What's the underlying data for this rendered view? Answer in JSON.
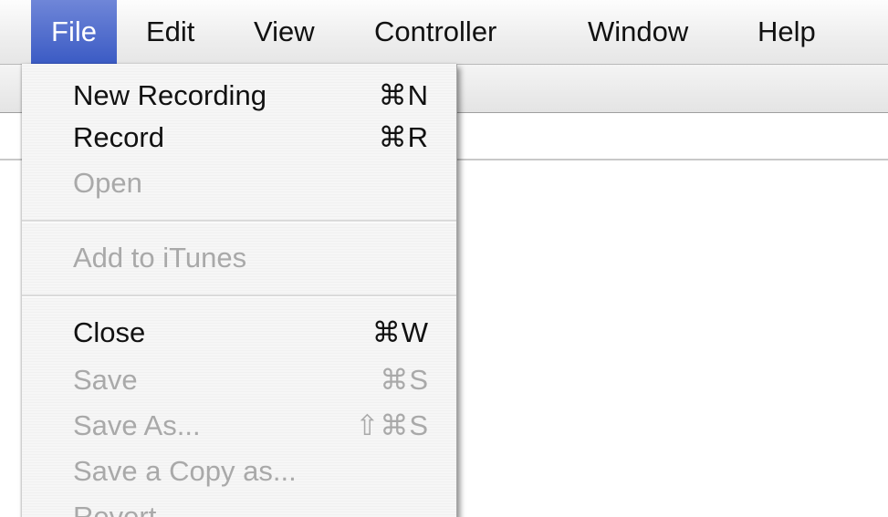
{
  "menubar": {
    "items": [
      {
        "label": "File"
      },
      {
        "label": "Edit"
      },
      {
        "label": "View"
      },
      {
        "label": "Controller"
      },
      {
        "label": "Window"
      },
      {
        "label": "Help"
      }
    ]
  },
  "file_menu": {
    "items": [
      {
        "label": "New Recording",
        "shortcut": "⌘N",
        "enabled": true
      },
      {
        "label": "Record",
        "shortcut": "⌘R",
        "enabled": true
      },
      {
        "label": "Open",
        "shortcut": "",
        "enabled": false
      },
      {
        "label": "Add to iTunes",
        "shortcut": "",
        "enabled": false
      },
      {
        "label": "Close",
        "shortcut": "⌘W",
        "enabled": true
      },
      {
        "label": "Save",
        "shortcut": "⌘S",
        "enabled": false
      },
      {
        "label": "Save As...",
        "shortcut": "⇧⌘S",
        "enabled": false
      },
      {
        "label": "Save a Copy as...",
        "shortcut": "",
        "enabled": false
      },
      {
        "label": "Revert",
        "shortcut": "",
        "enabled": false
      }
    ]
  },
  "colors": {
    "menu_highlight": "#4a67cc",
    "enabled_text": "#111111",
    "disabled_text": "#a9a9a9"
  }
}
